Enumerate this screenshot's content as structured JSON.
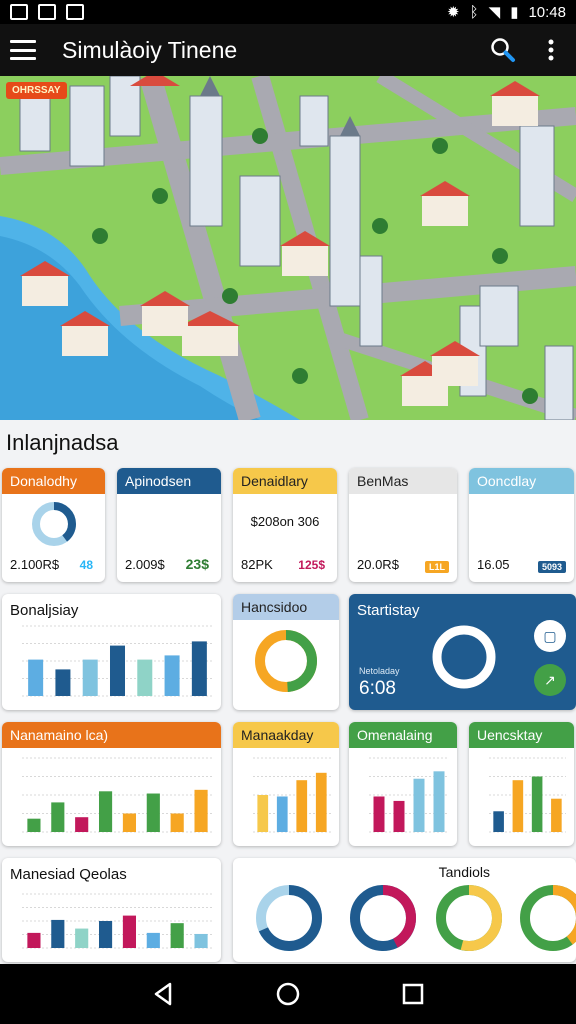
{
  "status_bar": {
    "time": "10:48"
  },
  "app_bar": {
    "title": "Simulàoiy Tinene"
  },
  "hero": {
    "tag": "OHRSSAY"
  },
  "section": {
    "title": "Inlanjnadsa"
  },
  "stat_cards": [
    {
      "title": "Donalodhy",
      "value": "2.100R$",
      "chip": "48",
      "color": "#e8731a",
      "chip_color": "#29b6f6"
    },
    {
      "title": "Apinodsen",
      "value": "2.009$",
      "chip": "23$",
      "color": "#1f5b8f",
      "chip_color": "#2e7d32"
    },
    {
      "title": "Denaidlary",
      "mid": "$208on 306",
      "value": "82PK",
      "chip": "125$",
      "color": "#f6c84a",
      "chip_color": "#c2185b"
    },
    {
      "title": "BenMas",
      "value": "20.0R$",
      "chip": "L1L",
      "color": "#e6e6e6",
      "chip_color": "#f6a623"
    },
    {
      "title": "Ooncdlay",
      "value": "16.05",
      "chip": "5093",
      "color": "#7fc3df",
      "chip_color": "#1f5b8f"
    }
  ],
  "cards": {
    "bar1": {
      "title": "Bonaljsiay"
    },
    "donut1": {
      "title": "Hancsidoo"
    },
    "stats": {
      "title": "Startistay",
      "label": "Netoladay",
      "value": "6:08"
    },
    "bar2": {
      "title": "Nanamaino lca)"
    },
    "bar3": {
      "title": "Manaakday"
    },
    "bar4": {
      "title": "Omenalaing"
    },
    "bar5": {
      "title": "Uencsktay"
    },
    "bar6": {
      "title": "Manesiad Qeolas"
    },
    "donuts": {
      "title": "Tandiols"
    }
  },
  "chart_data": [
    {
      "type": "bar",
      "title": "Bonaljsiay",
      "series": [
        {
          "values": [
            52,
            38,
            52,
            72,
            52,
            58,
            78
          ]
        }
      ],
      "ylim": [
        0,
        100
      ]
    },
    {
      "type": "pie",
      "title": "Hancsidoo",
      "values": [
        45,
        30,
        25
      ]
    },
    {
      "type": "bar",
      "title": "Nanamaino lca)",
      "series": [
        {
          "values": [
            18,
            40,
            20,
            55,
            25,
            52,
            25,
            57
          ]
        }
      ],
      "ylim": [
        0,
        100
      ]
    },
    {
      "type": "bar",
      "title": "Manaakday",
      "series": [
        {
          "values": [
            50,
            48,
            70,
            80
          ]
        }
      ],
      "ylim": [
        0,
        100
      ]
    },
    {
      "type": "bar",
      "title": "Omenalaing",
      "series": [
        {
          "values": [
            48,
            42,
            72,
            82
          ]
        }
      ],
      "ylim": [
        0,
        100
      ]
    },
    {
      "type": "bar",
      "title": "Uencsktay",
      "series": [
        {
          "values": [
            28,
            70,
            75,
            45
          ]
        }
      ],
      "ylim": [
        0,
        100
      ]
    },
    {
      "type": "bar",
      "title": "Manesiad Qeolas",
      "series": [
        {
          "values": [
            28,
            52,
            36,
            50,
            60,
            28,
            46,
            26
          ]
        }
      ],
      "ylim": [
        0,
        100
      ]
    },
    {
      "type": "pie",
      "title": "Tandiols",
      "values": [
        60,
        40
      ]
    }
  ]
}
